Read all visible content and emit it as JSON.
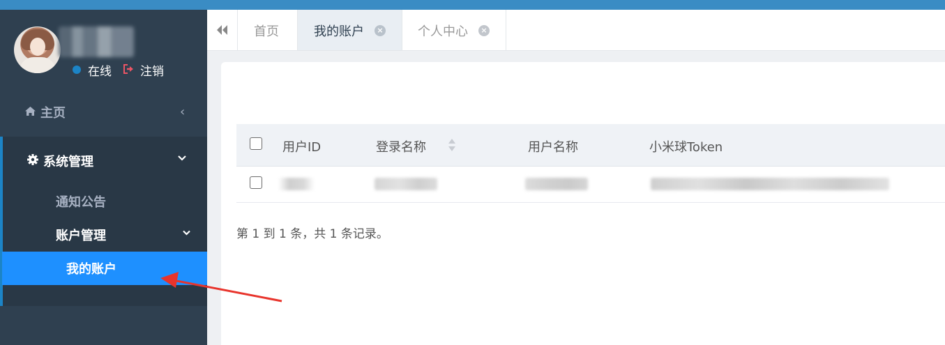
{
  "sidebar": {
    "profile": {
      "status": "在线",
      "logout": "注销"
    },
    "home": {
      "label": "主页"
    },
    "system": {
      "label": "系统管理",
      "items": [
        {
          "label": "通知公告"
        },
        {
          "label": "账户管理"
        },
        {
          "label": "我的账户"
        }
      ]
    }
  },
  "tabs": [
    {
      "label": "首页",
      "closable": false,
      "active": false
    },
    {
      "label": "我的账户",
      "closable": true,
      "active": true
    },
    {
      "label": "个人中心",
      "closable": true,
      "active": false
    }
  ],
  "table": {
    "columns": [
      "用户ID",
      "登录名称",
      "用户名称",
      "小米球Token"
    ],
    "sortable_column": "登录名称"
  },
  "pagination": {
    "summary": "第 1 到 1 条，共 1 条记录。"
  },
  "colors": {
    "sidebar_bg": "#2f4050",
    "accent": "#1c84c6",
    "active_item": "#1e90ff",
    "logout_icon": "#ed5565",
    "annotation_arrow": "#e8342c"
  }
}
